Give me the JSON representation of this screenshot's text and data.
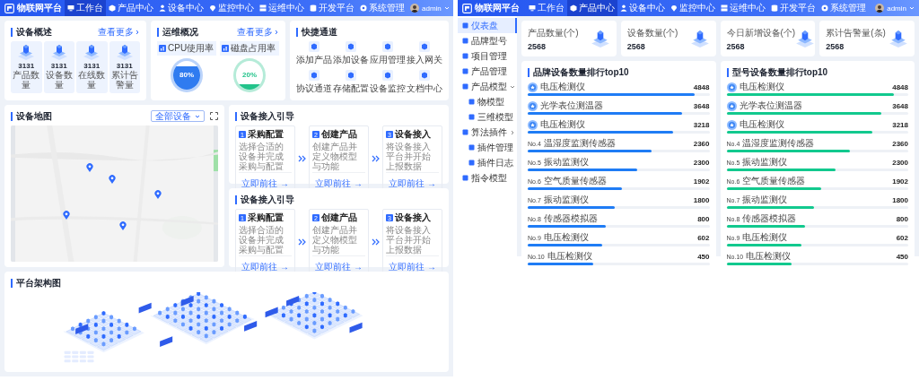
{
  "left": {
    "header": {
      "title": "物联网平台",
      "nav": [
        {
          "label": "工作台",
          "selected": true
        },
        {
          "label": "产品中心",
          "selected": false
        },
        {
          "label": "设备中心",
          "selected": false
        },
        {
          "label": "监控中心",
          "selected": false
        },
        {
          "label": "运维中心",
          "selected": false
        },
        {
          "label": "开发平台",
          "selected": false
        },
        {
          "label": "系统管理",
          "selected": false
        }
      ],
      "user": "admin"
    },
    "overview": {
      "title": "设备概述",
      "more": "查看更多",
      "stats": [
        {
          "value": "3131",
          "label": "产品数量"
        },
        {
          "value": "3131",
          "label": "设备数量"
        },
        {
          "value": "3131",
          "label": "在线数量"
        },
        {
          "value": "3131",
          "label": "累计告警量"
        }
      ]
    },
    "operations": {
      "title": "运维概况",
      "more": "查看更多",
      "gauges": [
        {
          "label": "CPU使用率",
          "value": "80%",
          "level": 0.8,
          "color": "#2f7bf0"
        },
        {
          "label": "磁盘占用率",
          "value": "20%",
          "level": 0.2,
          "color": "#22c38a"
        }
      ]
    },
    "quick": {
      "title": "快捷通道",
      "items": [
        "添加产品",
        "添加设备",
        "应用管理",
        "接入网关",
        "协议通道",
        "存储配置",
        "设备监控",
        "文档中心"
      ]
    },
    "map": {
      "title": "设备地图",
      "filter": "全部设备"
    },
    "guides": [
      {
        "title": "设备接入引导",
        "steps": [
          {
            "num": "1",
            "title": "采购配置",
            "text": "选择合适的设备并完成采购与配置",
            "link": "立即前往 →"
          },
          {
            "num": "2",
            "title": "创建产品",
            "text": "创建产品并定义物模型与功能",
            "link": "立即前往 →"
          },
          {
            "num": "3",
            "title": "设备接入",
            "text": "将设备接入平台并开始上报数据",
            "link": "立即前往 →"
          }
        ]
      },
      {
        "title": "设备接入引导",
        "steps": [
          {
            "num": "1",
            "title": "采购配置",
            "text": "选择合适的设备并完成采购与配置",
            "link": "立即前往 →"
          },
          {
            "num": "2",
            "title": "创建产品",
            "text": "创建产品并定义物模型与功能",
            "link": "立即前往 →"
          },
          {
            "num": "3",
            "title": "设备接入",
            "text": "将设备接入平台并开始上报数据",
            "link": "立即前往 →"
          }
        ]
      }
    ],
    "architecture": {
      "title": "平台架构图"
    }
  },
  "right": {
    "header": {
      "title": "物联网平台",
      "nav": [
        {
          "label": "工作台",
          "selected": false
        },
        {
          "label": "产品中心",
          "selected": true
        },
        {
          "label": "设备中心",
          "selected": false
        },
        {
          "label": "监控中心",
          "selected": false
        },
        {
          "label": "运维中心",
          "selected": false
        },
        {
          "label": "开发平台",
          "selected": false
        },
        {
          "label": "系统管理",
          "selected": false
        }
      ],
      "user": "admin"
    },
    "sidebar": [
      {
        "label": "仪表盘",
        "selected": true
      },
      {
        "label": "品牌型号",
        "selected": false
      },
      {
        "label": "项目管理",
        "selected": false
      },
      {
        "label": "产品管理",
        "selected": false
      },
      {
        "label": "产品模型",
        "selected": false,
        "expanded": true,
        "children": [
          {
            "label": "物模型",
            "selected": false
          },
          {
            "label": "三维模型",
            "selected": false
          }
        ]
      },
      {
        "label": "算法插件",
        "selected": false,
        "expanded": false,
        "children": [
          {
            "label": "插件管理",
            "selected": false
          },
          {
            "label": "插件日志",
            "selected": false
          }
        ]
      },
      {
        "label": "指令模型",
        "selected": false
      }
    ],
    "stats": [
      {
        "label": "产品数量(个)",
        "value": "2568"
      },
      {
        "label": "设备数量(个)",
        "value": "2568"
      },
      {
        "label": "今日新增设备(个)",
        "value": "2568"
      },
      {
        "label": "累计告警量(条)",
        "value": "2568"
      }
    ],
    "rankings": [
      {
        "title": "品牌设备数量排行top10",
        "color": "#1f7cf5",
        "items": [
          {
            "kind": "medal",
            "name": "电压检测仪",
            "value": "4848",
            "level": 0.92
          },
          {
            "kind": "medal",
            "name": "光学表位测温器",
            "value": "3648",
            "level": 0.85
          },
          {
            "kind": "medal",
            "name": "电压检测仪",
            "value": "3218",
            "level": 0.8
          },
          {
            "kind": "number",
            "rank": "No.4",
            "name": "温湿度监测传感器",
            "value": "2360",
            "level": 0.68
          },
          {
            "kind": "number",
            "rank": "No.5",
            "name": "振动监测仪",
            "value": "2300",
            "level": 0.6
          },
          {
            "kind": "number",
            "rank": "No.6",
            "name": "空气质量传感器",
            "value": "1902",
            "level": 0.52
          },
          {
            "kind": "number",
            "rank": "No.7",
            "name": "振动监测仪",
            "value": "1800",
            "level": 0.48
          },
          {
            "kind": "number",
            "rank": "No.8",
            "name": "传感器模拟器",
            "value": "800",
            "level": 0.43
          },
          {
            "kind": "number",
            "rank": "No.9",
            "name": "电压检测仪",
            "value": "602",
            "level": 0.41
          },
          {
            "kind": "number",
            "rank": "No.10",
            "name": "电压检测仪",
            "value": "450",
            "level": 0.36
          }
        ]
      },
      {
        "title": "型号设备数量排行top10",
        "color": "#12c98e",
        "items": [
          {
            "kind": "medal",
            "name": "电压检测仪",
            "value": "4848",
            "level": 0.92
          },
          {
            "kind": "medal",
            "name": "光学表位测温器",
            "value": "3648",
            "level": 0.85
          },
          {
            "kind": "medal",
            "name": "电压检测仪",
            "value": "3218",
            "level": 0.8
          },
          {
            "kind": "number",
            "rank": "No.4",
            "name": "温湿度监测传感器",
            "value": "2360",
            "level": 0.68
          },
          {
            "kind": "number",
            "rank": "No.5",
            "name": "振动监测仪",
            "value": "2300",
            "level": 0.6
          },
          {
            "kind": "number",
            "rank": "No.6",
            "name": "空气质量传感器",
            "value": "1902",
            "level": 0.52
          },
          {
            "kind": "number",
            "rank": "No.7",
            "name": "振动监测仪",
            "value": "1800",
            "level": 0.48
          },
          {
            "kind": "number",
            "rank": "No.8",
            "name": "传感器模拟器",
            "value": "800",
            "level": 0.43
          },
          {
            "kind": "number",
            "rank": "No.9",
            "name": "电压检测仪",
            "value": "602",
            "level": 0.41
          },
          {
            "kind": "number",
            "rank": "No.10",
            "name": "电压检测仪",
            "value": "450",
            "level": 0.36
          }
        ]
      }
    ]
  }
}
